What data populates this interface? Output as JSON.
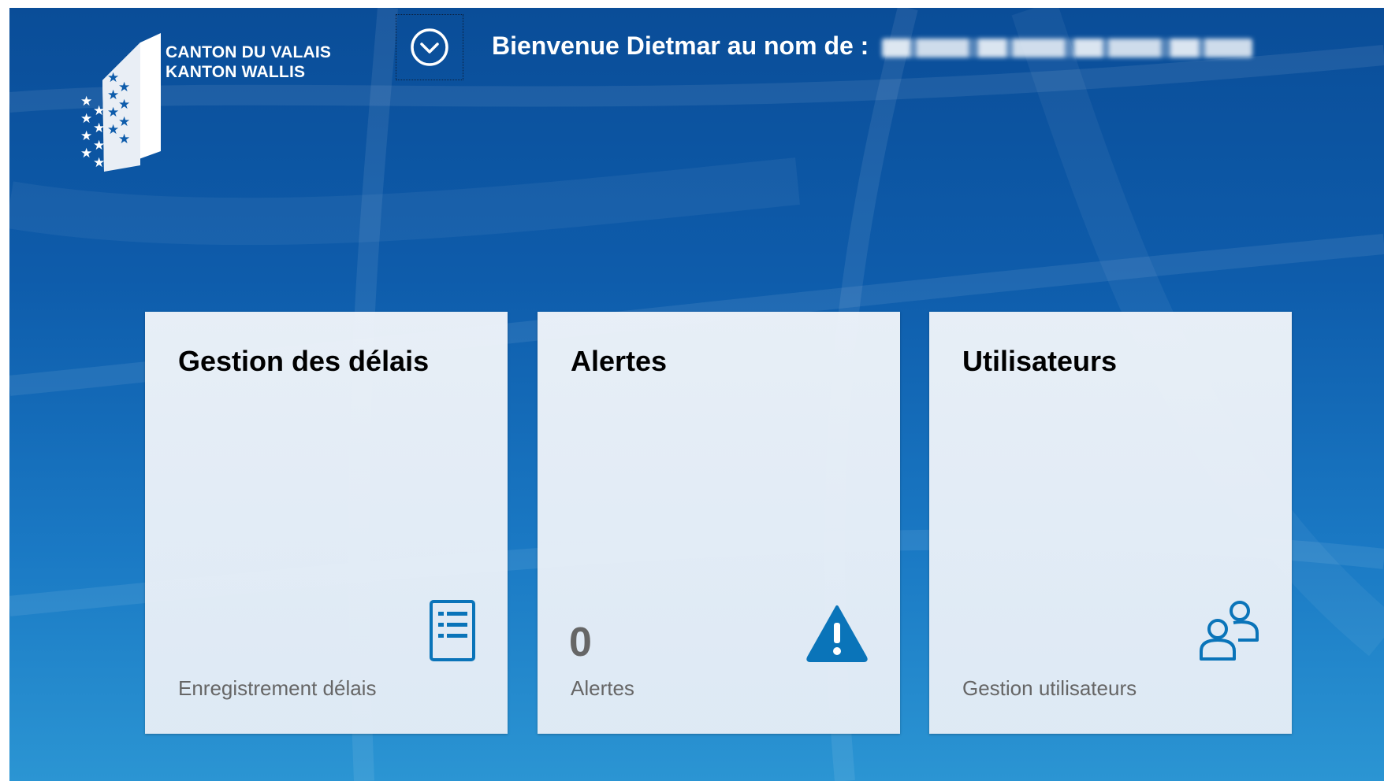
{
  "header": {
    "logo_line1": "CANTON DU VALAIS",
    "logo_line2": "KANTON WALLIS",
    "menu_icon": "chevron-down-circle-icon",
    "welcome_text": "Bienvenue Dietmar au nom de :"
  },
  "tiles": [
    {
      "title": "Gestion des délais",
      "subtitle": "Enregistrement délais",
      "icon": "list-document-icon"
    },
    {
      "title": "Alertes",
      "count": "0",
      "subtitle": "Alertes",
      "icon": "warning-icon"
    },
    {
      "title": "Utilisateurs",
      "subtitle": "Gestion utilisateurs",
      "icon": "users-icon"
    }
  ],
  "colors": {
    "background_top": "#0a4d98",
    "background_bottom": "#2b95d3",
    "tile_background": "#eef3f9",
    "icon_blue": "#0a74b9",
    "subtitle_gray": "#666666"
  }
}
